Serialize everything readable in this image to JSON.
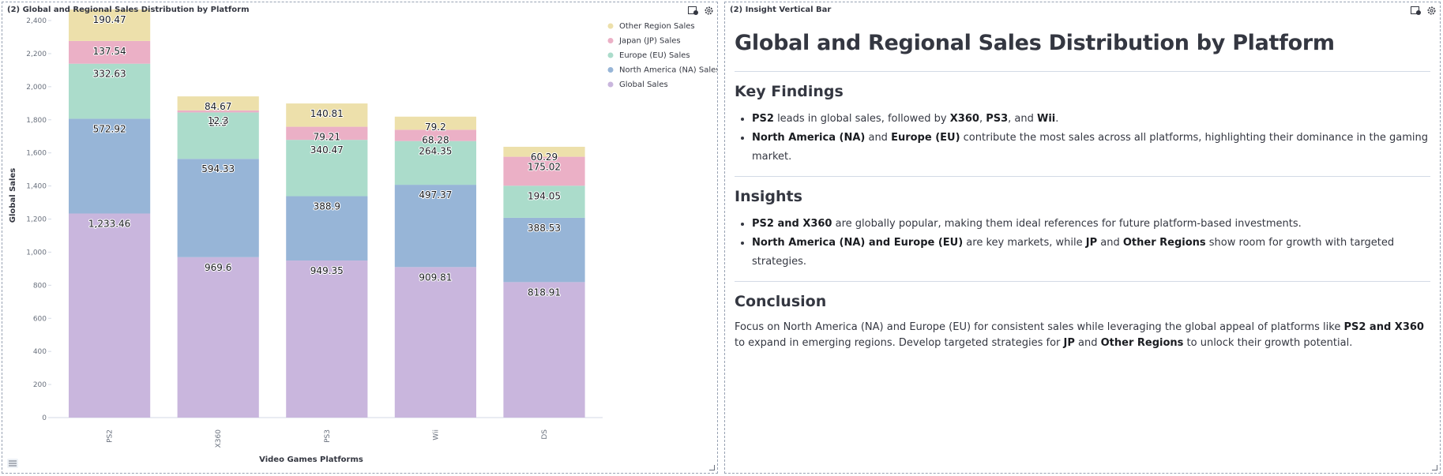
{
  "left_panel": {
    "title": "(2) Global and Regional Sales Distribution by Platform",
    "icons": [
      "export-icon",
      "gear-icon"
    ]
  },
  "right_panel": {
    "title": "(2) Insight Vertical Bar",
    "icons": [
      "export-icon",
      "gear-icon"
    ]
  },
  "chart_data": {
    "type": "bar",
    "stacked": true,
    "categories": [
      "PS2",
      "X360",
      "PS3",
      "Wii",
      "DS"
    ],
    "xlabel": "Video Games Platforms",
    "ylabel": "Global Sales",
    "ylim": [
      0,
      2400
    ],
    "yticks": [
      0,
      200,
      400,
      600,
      800,
      1000,
      1200,
      1400,
      1600,
      1800,
      2000,
      2200,
      2400
    ],
    "ytick_labels": [
      "0",
      "200",
      "400",
      "600",
      "800",
      "1,000",
      "1,200",
      "1,400",
      "1,600",
      "1,800",
      "2,000",
      "2,200",
      "2,400"
    ],
    "grid": false,
    "legend_position": "top-right",
    "series": [
      {
        "name": "Global Sales",
        "color": "#c9b6dd",
        "values": [
          1233.46,
          969.6,
          949.35,
          909.81,
          818.91
        ],
        "labels": [
          "1,233.46",
          "969.6",
          "949.35",
          "909.81",
          "818.91"
        ]
      },
      {
        "name": "North America (NA) Sales",
        "color": "#97b5d7",
        "values": [
          572.92,
          594.33,
          388.9,
          497.37,
          388.53
        ],
        "labels": [
          "572.92",
          "594.33",
          "388.9",
          "497.37",
          "388.53"
        ]
      },
      {
        "name": "Europe (EU) Sales",
        "color": "#abdccb",
        "values": [
          332.63,
          280.58,
          340.47,
          264.35,
          194.05
        ],
        "labels": [
          "332.63",
          "2..3",
          "340.47",
          "264.35",
          "194.05"
        ]
      },
      {
        "name": "Japan (JP) Sales",
        "color": "#ebb0c6",
        "values": [
          137.54,
          12.3,
          79.21,
          68.28,
          175.02
        ],
        "labels": [
          "137.54",
          "12.3",
          "79.21",
          "68.28",
          "175.02"
        ]
      },
      {
        "name": "Other Region Sales",
        "color": "#ede0ab",
        "values": [
          190.47,
          84.67,
          140.81,
          79.2,
          60.29
        ],
        "labels": [
          "190.47",
          "84.67",
          "140.81",
          "79.2",
          "60.29"
        ]
      }
    ],
    "legend_order": [
      "Other Region Sales",
      "Japan (JP) Sales",
      "Europe (EU) Sales",
      "North America (NA) Sales",
      "Global Sales"
    ]
  },
  "insight": {
    "title": "Global and Regional Sales Distribution by Platform",
    "key_findings": {
      "heading": "Key Findings",
      "items": [
        [
          {
            "t": "PS2",
            "b": true
          },
          {
            "t": " leads in global sales, followed by "
          },
          {
            "t": "X360",
            "b": true
          },
          {
            "t": ", "
          },
          {
            "t": "PS3",
            "b": true
          },
          {
            "t": ", and "
          },
          {
            "t": "Wii",
            "b": true
          },
          {
            "t": "."
          }
        ],
        [
          {
            "t": "North America (NA)",
            "b": true
          },
          {
            "t": " and "
          },
          {
            "t": "Europe (EU)",
            "b": true
          },
          {
            "t": " contribute the most sales across all platforms, highlighting their dominance in the gaming market."
          }
        ]
      ]
    },
    "insights": {
      "heading": "Insights",
      "items": [
        [
          {
            "t": "PS2 and X360",
            "b": true
          },
          {
            "t": " are globally popular, making them ideal references for future platform-based investments."
          }
        ],
        [
          {
            "t": "North America (NA) and Europe (EU)",
            "b": true
          },
          {
            "t": " are key markets, while "
          },
          {
            "t": "JP",
            "b": true
          },
          {
            "t": " and "
          },
          {
            "t": "Other Regions",
            "b": true
          },
          {
            "t": " show room for growth with targeted strategies."
          }
        ]
      ]
    },
    "conclusion": {
      "heading": "Conclusion",
      "text": [
        {
          "t": "Focus on North America (NA) and Europe (EU) for consistent sales while leveraging the global appeal of platforms like "
        },
        {
          "t": "PS2 and X360",
          "b": true
        },
        {
          "t": " to expand in emerging regions. Develop targeted strategies for "
        },
        {
          "t": "JP",
          "b": true
        },
        {
          "t": " and "
        },
        {
          "t": "Other Regions",
          "b": true
        },
        {
          "t": " to unlock their growth potential."
        }
      ]
    }
  }
}
